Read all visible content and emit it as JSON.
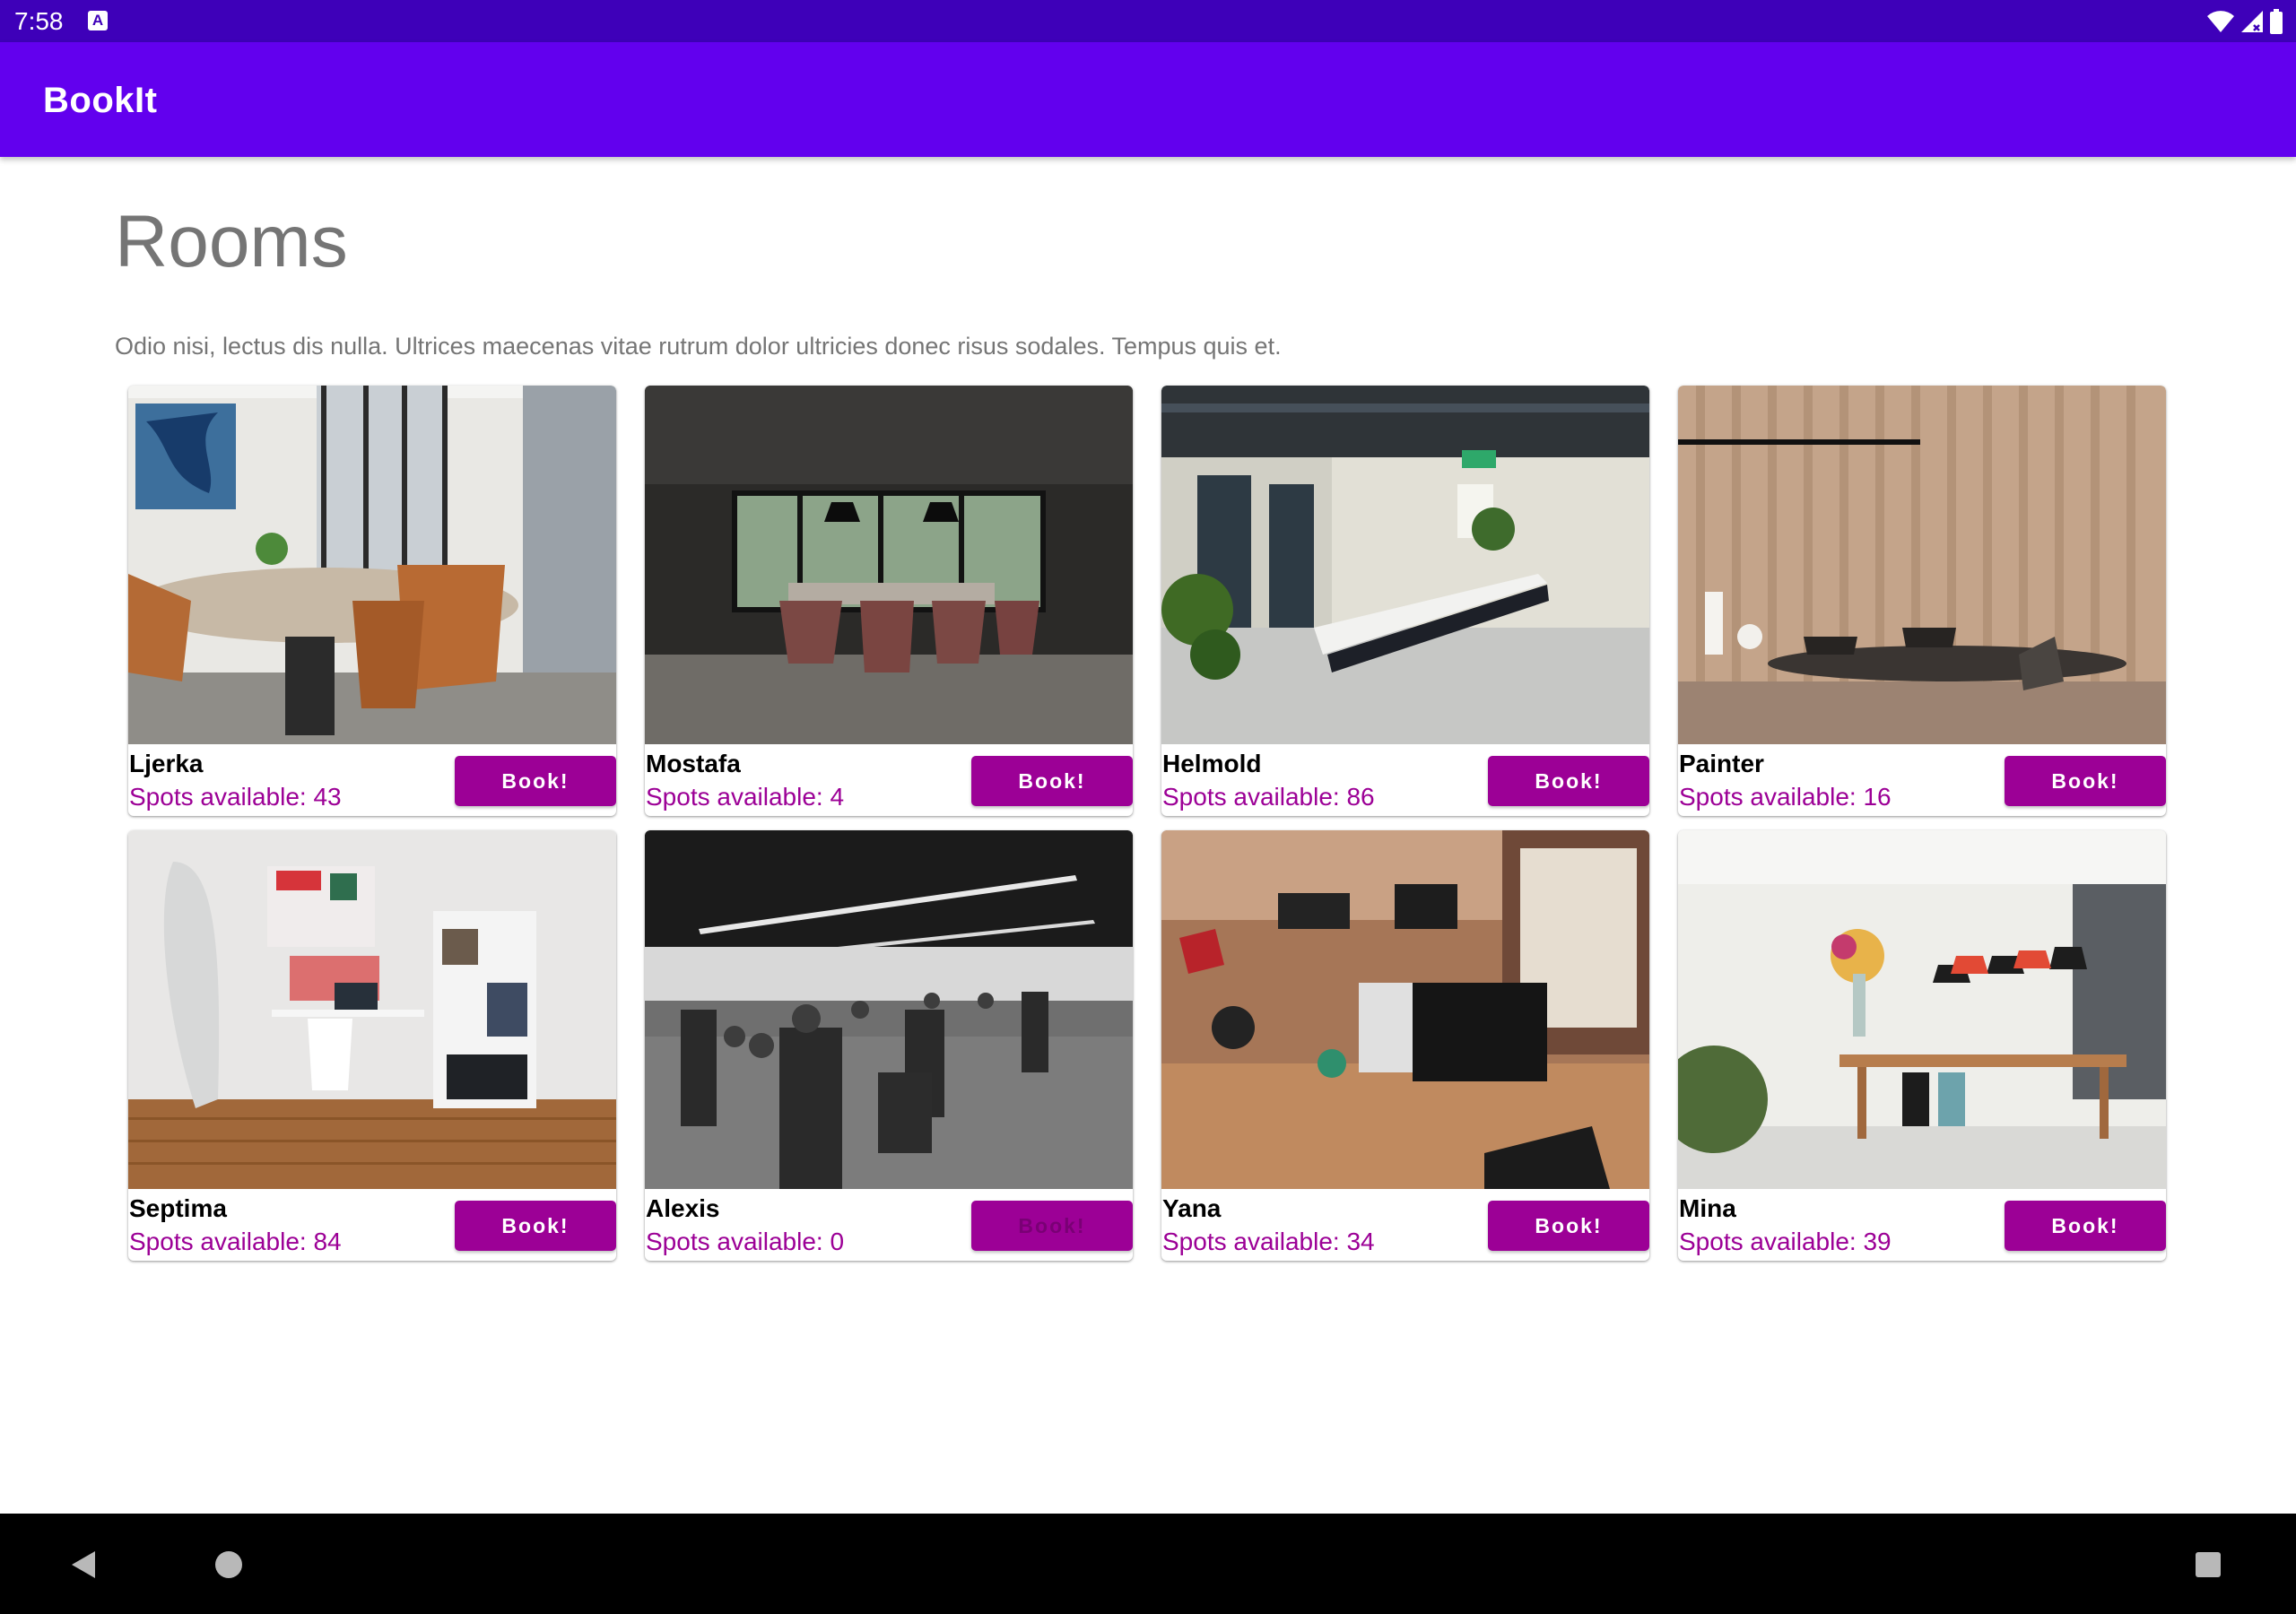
{
  "status_bar": {
    "time": "7:58",
    "notification_letter": "A",
    "icons": [
      "wifi-icon",
      "signal-icon",
      "battery-icon"
    ]
  },
  "app_bar": {
    "title": "BookIt",
    "color": "#6200ee"
  },
  "page": {
    "title": "Rooms",
    "description": "Odio nisi, lectus dis nulla. Ultrices maecenas vitae rutrum dolor ultricies donec risus sodales. Tempus quis et."
  },
  "rooms": [
    {
      "name": "Ljerka",
      "spots": "Spots available: 43",
      "button": "Book!",
      "enabled": true
    },
    {
      "name": "Mostafa",
      "spots": "Spots available: 4",
      "button": "Book!",
      "enabled": true
    },
    {
      "name": "Helmold",
      "spots": "Spots available: 86",
      "button": "Book!",
      "enabled": true
    },
    {
      "name": "Painter",
      "spots": "Spots available: 16",
      "button": "Book!",
      "enabled": true
    },
    {
      "name": "Septima",
      "spots": "Spots available: 84",
      "button": "Book!",
      "enabled": true
    },
    {
      "name": "Alexis",
      "spots": "Spots available: 0",
      "button": "Book!",
      "enabled": false
    },
    {
      "name": "Yana",
      "spots": "Spots available: 34",
      "button": "Book!",
      "enabled": true
    },
    {
      "name": "Mina",
      "spots": "Spots available: 39",
      "button": "Book!",
      "enabled": true
    }
  ],
  "colors": {
    "accent": "#9c0096",
    "status_bar": "#3e00b9"
  },
  "nav_bar": {
    "icons": [
      "back-icon",
      "home-icon",
      "recents-icon"
    ]
  }
}
